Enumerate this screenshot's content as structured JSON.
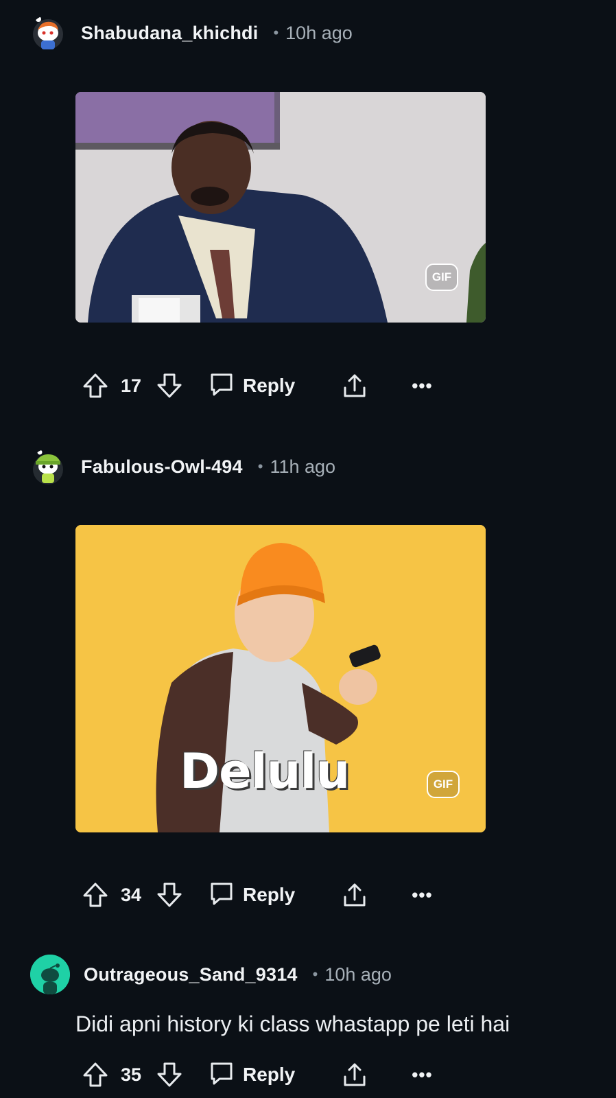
{
  "comments": [
    {
      "username": "Shabudana_khichdi",
      "time": "10h ago",
      "separator": "•",
      "gif_badge": "GIF",
      "votes": "17",
      "reply_label": "Reply",
      "more_label": "•••"
    },
    {
      "username": "Fabulous-Owl-494",
      "time": "11h ago",
      "separator": "•",
      "gif_badge": "GIF",
      "gif_caption": "Delulu",
      "votes": "34",
      "reply_label": "Reply",
      "more_label": "•••"
    },
    {
      "username": "Outrageous_Sand_9314",
      "time": "10h ago",
      "separator": "•",
      "text": "Didi apni history ki class whastapp pe leti hai",
      "votes": "35",
      "reply_label": "Reply",
      "more_label": "•••"
    }
  ],
  "colors": {
    "background": "#0b1016",
    "gif2_background": "#f6c445",
    "avatar3": "#1fd1a6"
  }
}
